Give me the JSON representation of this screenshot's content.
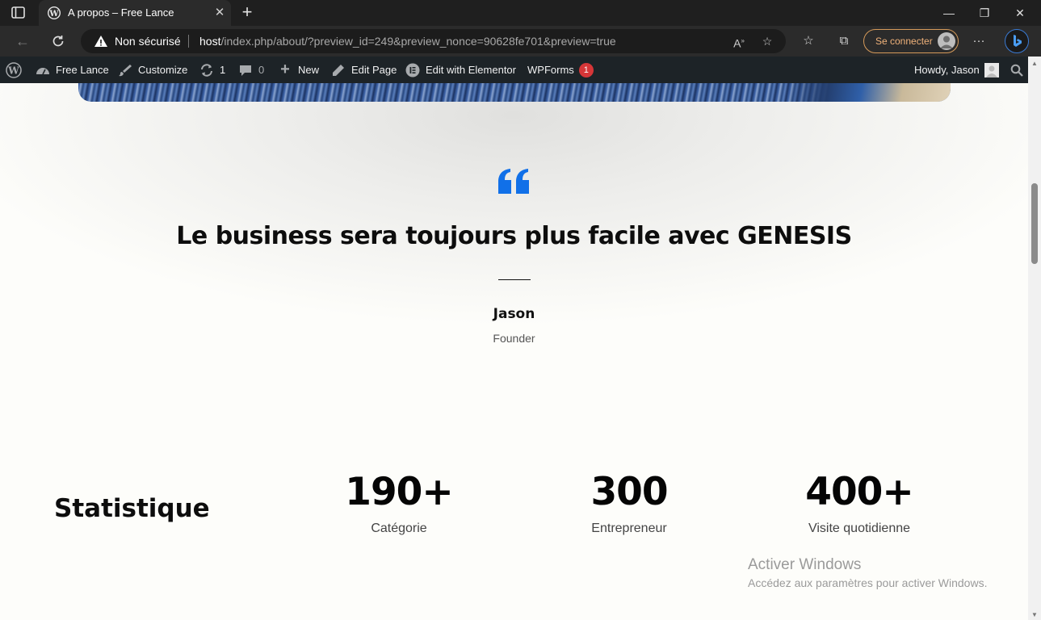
{
  "browser": {
    "tab": {
      "title": "A propos – Free Lance"
    },
    "address": {
      "security_label": "Non sécurisé",
      "url_host": "host",
      "url_path": "/index.php/about/?preview_id=249&preview_nonce=90628fe701&preview=true"
    },
    "signin_label": "Se connecter"
  },
  "admin_bar": {
    "site_name": "Free Lance",
    "customize": "Customize",
    "updates_count": "1",
    "comments_count": "0",
    "new_label": "New",
    "edit_page": "Edit Page",
    "edit_elementor": "Edit with Elementor",
    "wpforms": "WPForms",
    "wpforms_badge": "1",
    "howdy": "Howdy, Jason"
  },
  "testimonial": {
    "quote": "Le business sera toujours plus facile avec GENESIS",
    "author": "Jason",
    "role": "Founder"
  },
  "stats": {
    "title": "Statistique",
    "items": [
      {
        "value": "190+",
        "label": "Catégorie"
      },
      {
        "value": "300",
        "label": "Entrepreneur"
      },
      {
        "value": "400+",
        "label": "Visite quotidienne"
      }
    ]
  },
  "watermark": {
    "title": "Activer Windows",
    "subtitle": "Accédez aux paramètres pour activer Windows."
  },
  "colors": {
    "accent_blue": "#1170e8",
    "admin_bar_bg": "#1d2327",
    "badge_red": "#d63638",
    "signin_orange": "#f0b27a"
  }
}
